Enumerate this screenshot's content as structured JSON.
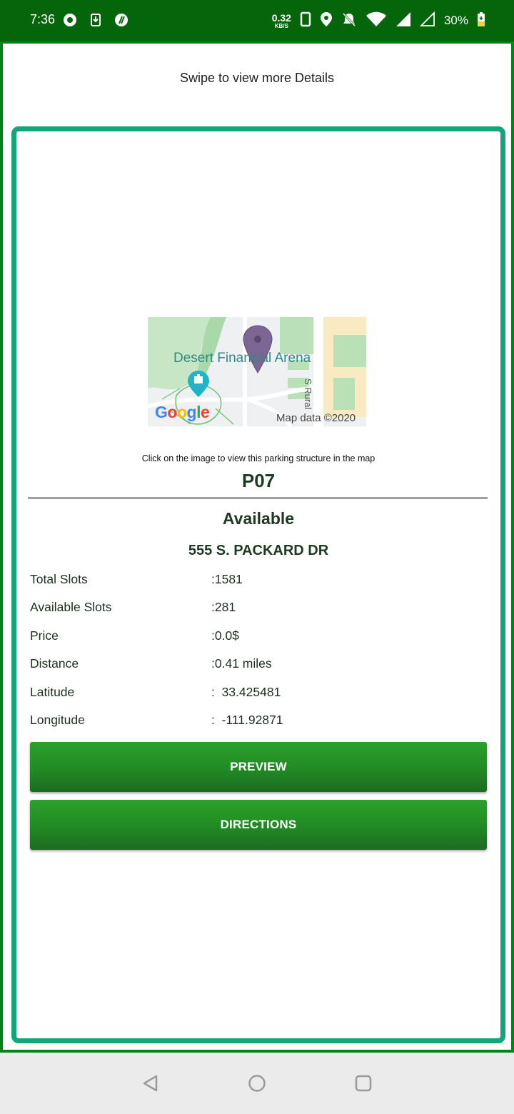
{
  "status_bar": {
    "time": "7:36",
    "net_speed_value": "0.32",
    "net_speed_unit": "KB/S",
    "battery": "30%"
  },
  "header": {
    "swipe_hint": "Swipe to view more Details"
  },
  "map": {
    "place_label": "Desert Financial Arena",
    "road_label": "S Rural",
    "attribution": "Map data ©2020",
    "logo_text": "Google",
    "caption": "Click on the image to view this parking structure in the map"
  },
  "parking": {
    "name": "P07",
    "status": "Available",
    "address": "555 S. PACKARD DR",
    "details": [
      {
        "label": "Total Slots",
        "value": ":1581"
      },
      {
        "label": "Available Slots",
        "value": ":281"
      },
      {
        "label": "Price",
        "value": ":0.0$"
      },
      {
        "label": "Distance",
        "value": ":0.41 miles"
      },
      {
        "label": "Latitude",
        "value": ":  33.425481"
      },
      {
        "label": "Longitude",
        "value": ":  -111.92871"
      }
    ]
  },
  "actions": {
    "preview_label": "PREVIEW",
    "directions_label": "DIRECTIONS"
  },
  "colors": {
    "status_bar": "#04650b",
    "frame_border": "#03821b",
    "card_border": "#12a67a",
    "button_green": "#218a24",
    "text_dark_green": "#1e3a22"
  }
}
